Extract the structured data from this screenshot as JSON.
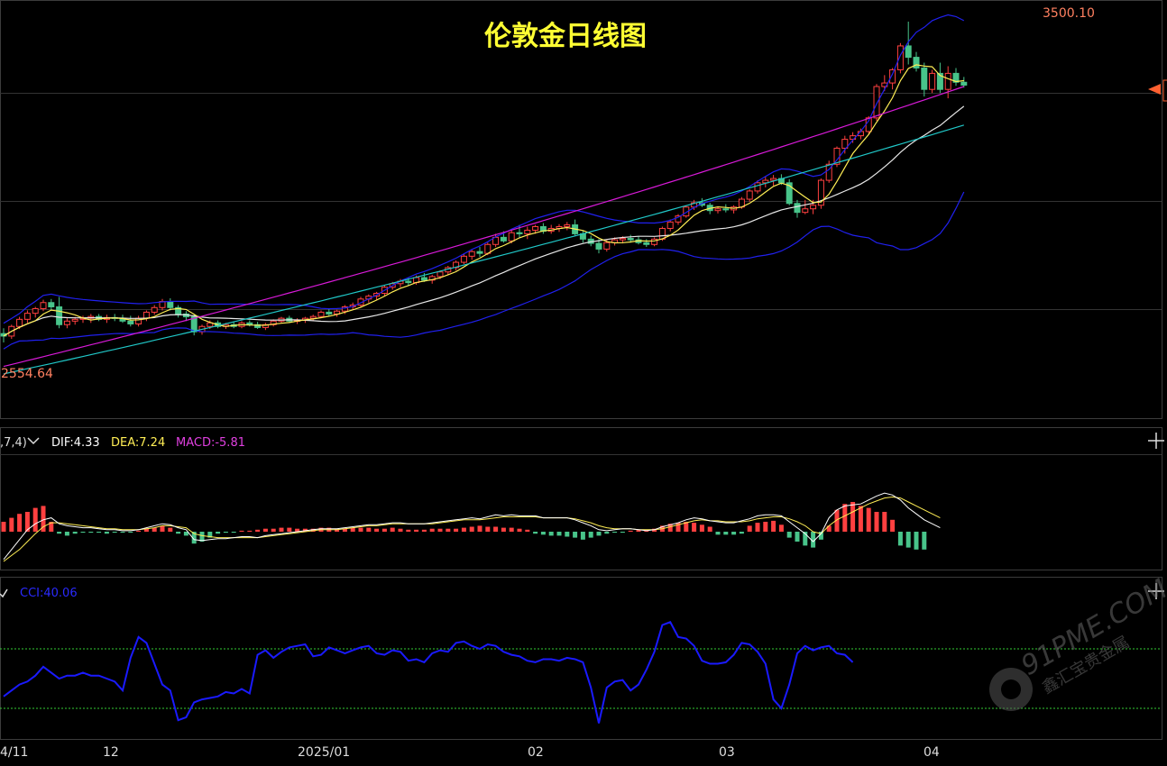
{
  "chart_data": {
    "type": "candlestick",
    "title": "伦敦金日线图",
    "x_ticks": [
      "4/11",
      "12",
      "2025/01",
      "02",
      "03",
      "04"
    ],
    "high_label": "3500.10",
    "low_label": "2554.64",
    "price_range": [
      2554.64,
      3500.1
    ],
    "candles": [
      {
        "o": 2625,
        "h": 2640,
        "l": 2600,
        "c": 2618
      },
      {
        "o": 2618,
        "h": 2650,
        "l": 2610,
        "c": 2645
      },
      {
        "o": 2645,
        "h": 2672,
        "l": 2638,
        "c": 2665
      },
      {
        "o": 2665,
        "h": 2690,
        "l": 2655,
        "c": 2682
      },
      {
        "o": 2682,
        "h": 2700,
        "l": 2670,
        "c": 2695
      },
      {
        "o": 2695,
        "h": 2720,
        "l": 2688,
        "c": 2712
      },
      {
        "o": 2712,
        "h": 2722,
        "l": 2690,
        "c": 2700
      },
      {
        "o": 2700,
        "h": 2728,
        "l": 2640,
        "c": 2650
      },
      {
        "o": 2650,
        "h": 2668,
        "l": 2640,
        "c": 2660
      },
      {
        "o": 2660,
        "h": 2672,
        "l": 2650,
        "c": 2665
      },
      {
        "o": 2665,
        "h": 2675,
        "l": 2655,
        "c": 2668
      },
      {
        "o": 2668,
        "h": 2680,
        "l": 2655,
        "c": 2673
      },
      {
        "o": 2673,
        "h": 2680,
        "l": 2660,
        "c": 2665
      },
      {
        "o": 2665,
        "h": 2678,
        "l": 2655,
        "c": 2670
      },
      {
        "o": 2670,
        "h": 2680,
        "l": 2660,
        "c": 2668
      },
      {
        "o": 2668,
        "h": 2678,
        "l": 2655,
        "c": 2660
      },
      {
        "o": 2660,
        "h": 2675,
        "l": 2645,
        "c": 2652
      },
      {
        "o": 2652,
        "h": 2675,
        "l": 2645,
        "c": 2668
      },
      {
        "o": 2668,
        "h": 2690,
        "l": 2660,
        "c": 2685
      },
      {
        "o": 2685,
        "h": 2705,
        "l": 2678,
        "c": 2698
      },
      {
        "o": 2698,
        "h": 2722,
        "l": 2690,
        "c": 2715
      },
      {
        "o": 2715,
        "h": 2724,
        "l": 2690,
        "c": 2698
      },
      {
        "o": 2698,
        "h": 2705,
        "l": 2670,
        "c": 2680
      },
      {
        "o": 2680,
        "h": 2688,
        "l": 2660,
        "c": 2672
      },
      {
        "o": 2672,
        "h": 2678,
        "l": 2620,
        "c": 2630
      },
      {
        "o": 2630,
        "h": 2650,
        "l": 2622,
        "c": 2645
      },
      {
        "o": 2645,
        "h": 2662,
        "l": 2638,
        "c": 2655
      },
      {
        "o": 2655,
        "h": 2662,
        "l": 2640,
        "c": 2645
      },
      {
        "o": 2645,
        "h": 2655,
        "l": 2638,
        "c": 2650
      },
      {
        "o": 2650,
        "h": 2658,
        "l": 2640,
        "c": 2645
      },
      {
        "o": 2645,
        "h": 2660,
        "l": 2640,
        "c": 2655
      },
      {
        "o": 2655,
        "h": 2662,
        "l": 2645,
        "c": 2650
      },
      {
        "o": 2650,
        "h": 2658,
        "l": 2638,
        "c": 2642
      },
      {
        "o": 2642,
        "h": 2655,
        "l": 2635,
        "c": 2650
      },
      {
        "o": 2650,
        "h": 2665,
        "l": 2645,
        "c": 2660
      },
      {
        "o": 2660,
        "h": 2672,
        "l": 2655,
        "c": 2668
      },
      {
        "o": 2668,
        "h": 2675,
        "l": 2655,
        "c": 2660
      },
      {
        "o": 2660,
        "h": 2668,
        "l": 2652,
        "c": 2662
      },
      {
        "o": 2662,
        "h": 2672,
        "l": 2655,
        "c": 2668
      },
      {
        "o": 2668,
        "h": 2678,
        "l": 2660,
        "c": 2673
      },
      {
        "o": 2673,
        "h": 2690,
        "l": 2668,
        "c": 2685
      },
      {
        "o": 2685,
        "h": 2695,
        "l": 2675,
        "c": 2680
      },
      {
        "o": 2680,
        "h": 2692,
        "l": 2672,
        "c": 2688
      },
      {
        "o": 2688,
        "h": 2705,
        "l": 2680,
        "c": 2700
      },
      {
        "o": 2700,
        "h": 2712,
        "l": 2692,
        "c": 2705
      },
      {
        "o": 2705,
        "h": 2728,
        "l": 2700,
        "c": 2722
      },
      {
        "o": 2722,
        "h": 2735,
        "l": 2712,
        "c": 2730
      },
      {
        "o": 2730,
        "h": 2742,
        "l": 2720,
        "c": 2738
      },
      {
        "o": 2738,
        "h": 2760,
        "l": 2730,
        "c": 2755
      },
      {
        "o": 2755,
        "h": 2770,
        "l": 2748,
        "c": 2765
      },
      {
        "o": 2765,
        "h": 2778,
        "l": 2755,
        "c": 2772
      },
      {
        "o": 2772,
        "h": 2782,
        "l": 2760,
        "c": 2768
      },
      {
        "o": 2768,
        "h": 2788,
        "l": 2762,
        "c": 2782
      },
      {
        "o": 2782,
        "h": 2795,
        "l": 2770,
        "c": 2775
      },
      {
        "o": 2775,
        "h": 2790,
        "l": 2765,
        "c": 2785
      },
      {
        "o": 2785,
        "h": 2802,
        "l": 2778,
        "c": 2798
      },
      {
        "o": 2798,
        "h": 2815,
        "l": 2790,
        "c": 2810
      },
      {
        "o": 2810,
        "h": 2830,
        "l": 2802,
        "c": 2825
      },
      {
        "o": 2825,
        "h": 2848,
        "l": 2820,
        "c": 2842
      },
      {
        "o": 2842,
        "h": 2860,
        "l": 2832,
        "c": 2855
      },
      {
        "o": 2855,
        "h": 2868,
        "l": 2840,
        "c": 2850
      },
      {
        "o": 2850,
        "h": 2880,
        "l": 2845,
        "c": 2875
      },
      {
        "o": 2875,
        "h": 2905,
        "l": 2868,
        "c": 2895
      },
      {
        "o": 2895,
        "h": 2912,
        "l": 2880,
        "c": 2885
      },
      {
        "o": 2885,
        "h": 2918,
        "l": 2878,
        "c": 2908
      },
      {
        "o": 2908,
        "h": 2930,
        "l": 2895,
        "c": 2905
      },
      {
        "o": 2905,
        "h": 2925,
        "l": 2890,
        "c": 2915
      },
      {
        "o": 2915,
        "h": 2930,
        "l": 2905,
        "c": 2925
      },
      {
        "o": 2925,
        "h": 2935,
        "l": 2905,
        "c": 2912
      },
      {
        "o": 2912,
        "h": 2930,
        "l": 2905,
        "c": 2920
      },
      {
        "o": 2920,
        "h": 2932,
        "l": 2910,
        "c": 2925
      },
      {
        "o": 2925,
        "h": 2938,
        "l": 2915,
        "c": 2930
      },
      {
        "o": 2930,
        "h": 2945,
        "l": 2900,
        "c": 2905
      },
      {
        "o": 2905,
        "h": 2915,
        "l": 2880,
        "c": 2890
      },
      {
        "o": 2890,
        "h": 2900,
        "l": 2870,
        "c": 2878
      },
      {
        "o": 2878,
        "h": 2890,
        "l": 2850,
        "c": 2862
      },
      {
        "o": 2862,
        "h": 2888,
        "l": 2855,
        "c": 2880
      },
      {
        "o": 2880,
        "h": 2895,
        "l": 2872,
        "c": 2888
      },
      {
        "o": 2888,
        "h": 2898,
        "l": 2878,
        "c": 2892
      },
      {
        "o": 2892,
        "h": 2902,
        "l": 2880,
        "c": 2888
      },
      {
        "o": 2888,
        "h": 2898,
        "l": 2875,
        "c": 2880
      },
      {
        "o": 2880,
        "h": 2890,
        "l": 2868,
        "c": 2875
      },
      {
        "o": 2875,
        "h": 2895,
        "l": 2870,
        "c": 2890
      },
      {
        "o": 2890,
        "h": 2925,
        "l": 2885,
        "c": 2920
      },
      {
        "o": 2920,
        "h": 2945,
        "l": 2912,
        "c": 2938
      },
      {
        "o": 2938,
        "h": 2960,
        "l": 2930,
        "c": 2955
      },
      {
        "o": 2955,
        "h": 2985,
        "l": 2950,
        "c": 2980
      },
      {
        "o": 2980,
        "h": 3000,
        "l": 2972,
        "c": 2992
      },
      {
        "o": 2992,
        "h": 3005,
        "l": 2980,
        "c": 2985
      },
      {
        "o": 2985,
        "h": 2992,
        "l": 2960,
        "c": 2970
      },
      {
        "o": 2970,
        "h": 2982,
        "l": 2962,
        "c": 2975
      },
      {
        "o": 2975,
        "h": 2988,
        "l": 2965,
        "c": 2972
      },
      {
        "o": 2972,
        "h": 2985,
        "l": 2962,
        "c": 2980
      },
      {
        "o": 2980,
        "h": 3008,
        "l": 2975,
        "c": 3002
      },
      {
        "o": 3002,
        "h": 3030,
        "l": 2995,
        "c": 3025
      },
      {
        "o": 3025,
        "h": 3055,
        "l": 3018,
        "c": 3048
      },
      {
        "o": 3048,
        "h": 3065,
        "l": 3035,
        "c": 3055
      },
      {
        "o": 3055,
        "h": 3070,
        "l": 3040,
        "c": 3060
      },
      {
        "o": 3060,
        "h": 3072,
        "l": 3042,
        "c": 3048
      },
      {
        "o": 3048,
        "h": 3058,
        "l": 2985,
        "c": 2990
      },
      {
        "o": 2990,
        "h": 3000,
        "l": 2950,
        "c": 2965
      },
      {
        "o": 2965,
        "h": 3000,
        "l": 2960,
        "c": 2975
      },
      {
        "o": 2975,
        "h": 3000,
        "l": 2960,
        "c": 2985
      },
      {
        "o": 2985,
        "h": 3060,
        "l": 2975,
        "c": 3055
      },
      {
        "o": 3055,
        "h": 3110,
        "l": 3048,
        "c": 3100
      },
      {
        "o": 3100,
        "h": 3150,
        "l": 3092,
        "c": 3145
      },
      {
        "o": 3145,
        "h": 3180,
        "l": 3130,
        "c": 3170
      },
      {
        "o": 3170,
        "h": 3190,
        "l": 3160,
        "c": 3180
      },
      {
        "o": 3180,
        "h": 3200,
        "l": 3170,
        "c": 3192
      },
      {
        "o": 3192,
        "h": 3235,
        "l": 3185,
        "c": 3230
      },
      {
        "o": 3230,
        "h": 3325,
        "l": 3222,
        "c": 3318
      },
      {
        "o": 3318,
        "h": 3350,
        "l": 3305,
        "c": 3328
      },
      {
        "o": 3328,
        "h": 3370,
        "l": 3310,
        "c": 3365
      },
      {
        "o": 3365,
        "h": 3440,
        "l": 3355,
        "c": 3432
      },
      {
        "o": 3432,
        "h": 3500.1,
        "l": 3380,
        "c": 3400
      },
      {
        "o": 3400,
        "h": 3415,
        "l": 3360,
        "c": 3370
      },
      {
        "o": 3370,
        "h": 3385,
        "l": 3290,
        "c": 3310
      },
      {
        "o": 3310,
        "h": 3365,
        "l": 3300,
        "c": 3355
      },
      {
        "o": 3355,
        "h": 3385,
        "l": 3300,
        "c": 3310
      },
      {
        "o": 3310,
        "h": 3375,
        "l": 3285,
        "c": 3355
      },
      {
        "o": 3355,
        "h": 3370,
        "l": 3320,
        "c": 3330
      },
      {
        "o": 3330,
        "h": 3345,
        "l": 3315,
        "c": 3322
      }
    ],
    "macd": {
      "params_visible": ",7,4)",
      "dif_label": "DIF:4.33",
      "dea_label": "DEA:7.24",
      "macd_label": "MACD:-5.81",
      "dif": [
        -28,
        -18,
        -8,
        2,
        8,
        12,
        14,
        8,
        6,
        5,
        4,
        4,
        3,
        2,
        2,
        1,
        1,
        2,
        4,
        6,
        8,
        7,
        4,
        2,
        -8,
        -9,
        -8,
        -7,
        -7,
        -6,
        -5,
        -5,
        -6,
        -4,
        -3,
        -2,
        -1,
        0,
        1,
        2,
        3,
        3,
        3,
        4,
        5,
        6,
        7,
        7,
        8,
        9,
        9,
        8,
        8,
        8,
        9,
        10,
        11,
        12,
        13,
        14,
        13,
        15,
        17,
        16,
        17,
        16,
        16,
        16,
        14,
        14,
        14,
        14,
        12,
        9,
        6,
        2,
        1,
        2,
        3,
        3,
        2,
        1,
        2,
        5,
        7,
        9,
        12,
        14,
        13,
        11,
        10,
        9,
        9,
        11,
        13,
        16,
        17,
        17,
        16,
        10,
        4,
        -2,
        -10,
        -2,
        14,
        22,
        26,
        27,
        28,
        32,
        36,
        39,
        37,
        32,
        24,
        18,
        12,
        8,
        4
      ],
      "dea": [
        -30,
        -24,
        -18,
        -10,
        -2,
        5,
        9,
        9,
        8,
        7,
        6,
        5,
        4,
        3,
        3,
        2,
        2,
        2,
        3,
        4,
        6,
        6,
        5,
        4,
        -2,
        -4,
        -5,
        -6,
        -6,
        -6,
        -6,
        -6,
        -6,
        -5,
        -4,
        -3,
        -2,
        -1,
        0,
        1,
        2,
        2,
        2,
        3,
        4,
        5,
        6,
        6,
        7,
        8,
        8,
        8,
        8,
        8,
        8,
        9,
        10,
        11,
        12,
        12,
        12,
        13,
        14,
        15,
        15,
        15,
        15,
        15,
        14,
        14,
        14,
        14,
        13,
        11,
        9,
        6,
        4,
        3,
        3,
        3,
        2,
        2,
        2,
        3,
        5,
        7,
        9,
        11,
        12,
        11,
        11,
        10,
        10,
        10,
        11,
        13,
        14,
        15,
        15,
        13,
        10,
        6,
        0,
        -2,
        6,
        12,
        16,
        20,
        24,
        28,
        31,
        34,
        35,
        34,
        30,
        26,
        22,
        18,
        14
      ],
      "hist": [
        10,
        14,
        18,
        20,
        24,
        26,
        10,
        -2,
        -4,
        -2,
        -1,
        -1,
        -1,
        -2,
        -1,
        -1,
        -1,
        1,
        3,
        4,
        6,
        4,
        -2,
        -4,
        -12,
        -10,
        -6,
        -2,
        -1,
        -1,
        1,
        1,
        2,
        3,
        3,
        4,
        4,
        3,
        3,
        3,
        4,
        4,
        3,
        3,
        4,
        4,
        4,
        3,
        3,
        4,
        3,
        2,
        2,
        2,
        3,
        3,
        3,
        3,
        4,
        5,
        6,
        5,
        5,
        4,
        4,
        3,
        2,
        -2,
        -3,
        -4,
        -4,
        -5,
        -6,
        -8,
        -6,
        -4,
        -2,
        -1,
        -1,
        1,
        2,
        2,
        3,
        6,
        8,
        9,
        10,
        9,
        7,
        5,
        -3,
        -3,
        -3,
        -2,
        6,
        9,
        10,
        11,
        7,
        -6,
        -10,
        -14,
        -16,
        -8,
        6,
        22,
        28,
        30,
        26,
        24,
        20,
        20,
        12,
        -14,
        -16,
        -18,
        -18
      ]
    },
    "cci": {
      "label": "CCI:40.06",
      "values": [
        -60,
        -40,
        -20,
        -10,
        10,
        40,
        20,
        0,
        10,
        10,
        20,
        10,
        10,
        0,
        -10,
        -40,
        70,
        140,
        120,
        50,
        -20,
        -40,
        -140,
        -130,
        -80,
        -70,
        -65,
        -60,
        -45,
        -50,
        -35,
        -50,
        80,
        95,
        70,
        90,
        105,
        110,
        115,
        75,
        80,
        105,
        95,
        85,
        95,
        105,
        110,
        85,
        80,
        95,
        90,
        60,
        65,
        55,
        85,
        95,
        90,
        120,
        125,
        110,
        100,
        115,
        110,
        90,
        80,
        75,
        60,
        55,
        65,
        65,
        60,
        70,
        65,
        55,
        -30,
        -150,
        -30,
        -10,
        -5,
        -40,
        -20,
        30,
        90,
        180,
        190,
        140,
        135,
        110,
        60,
        50,
        50,
        55,
        80,
        120,
        115,
        90,
        50,
        -70,
        -100,
        -20,
        85,
        110,
        95,
        105,
        110,
        85,
        80,
        55
      ],
      "upper": 100,
      "lower": -100
    }
  },
  "watermark": {
    "brand": "91PME.COM",
    "cn": "鑫汇宝贵金属"
  },
  "colors": {
    "up": "#ff4040",
    "down": "#48c48a",
    "ma5": "#ffee55",
    "ma20": "#e8e8e8",
    "boll": "#2020ee",
    "ma60": "#d81ad8",
    "ma120": "#20c8c8",
    "dif": "#ffffff",
    "dea": "#ffee55",
    "cci": "#1a1aff",
    "cci_band": "#33cc33"
  }
}
